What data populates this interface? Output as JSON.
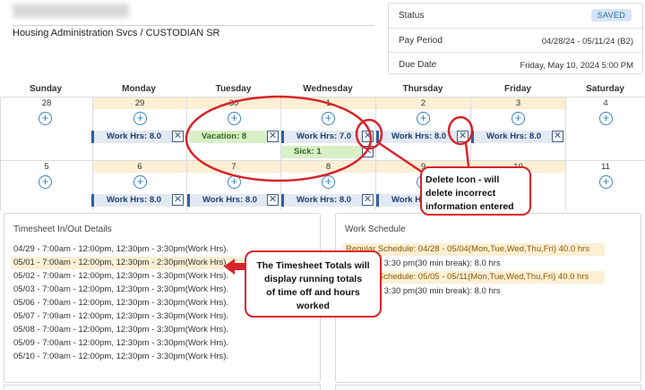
{
  "header": {
    "dept": "Housing Administration Svcs / CUSTODIAN SR"
  },
  "status_card": {
    "status_label": "Status",
    "status_value": "SAVED",
    "pay_period_label": "Pay Period",
    "pay_period_value": "04/28/24 - 05/11/24 (B2)",
    "due_date_label": "Due Date",
    "due_date_value": "Friday, May 10, 2024 5:00 PM"
  },
  "calendar": {
    "days": [
      "Sunday",
      "Monday",
      "Tuesday",
      "Wednesday",
      "Thursday",
      "Friday",
      "Saturday"
    ],
    "week1": {
      "dates": [
        "28",
        "29",
        "30",
        "1",
        "2",
        "3",
        "4"
      ],
      "entries": {
        "mon": "Work Hrs: 8.0",
        "tue": "Vacation: 8",
        "wed": "Work Hrs: 7.0",
        "wed_sick": "Sick: 1",
        "thu": "Work Hrs: 8.0",
        "fri": "Work Hrs: 8.0"
      }
    },
    "week2": {
      "dates": [
        "5",
        "6",
        "7",
        "8",
        "9",
        "10",
        "11"
      ],
      "entries": {
        "mon": "Work Hrs: 8.0",
        "tue": "Work Hrs: 8.0",
        "wed": "Work Hrs: 8.0",
        "thu": "Work Hrs: 8.0"
      }
    },
    "delete_glyph": "✕",
    "add_glyph": "+"
  },
  "timesheet": {
    "title": "Timesheet In/Out Details",
    "lines": [
      "04/29 - 7:00am - 12:00pm, 12:30pm - 3:30pm(Work Hrs).",
      "05/01 - 7:00am - 12:00pm, 12:30pm - 2:30pm(Work Hrs).",
      "05/02 - 7:00am - 12:00pm, 12:30pm - 3:30pm(Work Hrs).",
      "05/03 - 7:00am - 12:00pm, 12:30pm - 3:30pm(Work Hrs).",
      "05/06 - 7:00am - 12:00pm, 12:30pm - 3:30pm(Work Hrs).",
      "05/07 - 7:00am - 12:00pm, 12:30pm - 3:30pm(Work Hrs).",
      "05/08 - 7:00am - 12:00pm, 12:30pm - 3:30pm(Work Hrs).",
      "05/09 - 7:00am - 12:00pm, 12:30pm - 3:30pm(Work Hrs).",
      "05/10 - 7:00am - 12:00pm, 12:30pm - 3:30pm(Work Hrs)."
    ]
  },
  "schedule": {
    "title": "Work Schedule",
    "lines": [
      "Regular Schedule: 04/28 - 05/04(Mon,Tue,Wed,Thu,Fri) 40.0 hrs",
      "7:00 am - 3:30 pm(30 min break): 8.0 hrs",
      "Regular Schedule: 05/05 - 05/11(Mon,Tue,Wed,Thu,Fri) 40.0 hrs",
      "7:00 am - 3:30 pm(30 min break): 8.0 hrs"
    ]
  },
  "annotations": {
    "delete_callout": [
      "Delete Icon - will",
      "delete incorrect",
      "information entered"
    ],
    "totals_callout": [
      "The Timesheet Totals will",
      "display running totals",
      "of time off and hours",
      "worked"
    ]
  },
  "colors": {
    "accent": "#3a82c4",
    "highlight": "#fcefd4",
    "annotation": "#d8232a",
    "leave_bg": "#d9efc8",
    "work_bg": "#e2e9f2"
  }
}
